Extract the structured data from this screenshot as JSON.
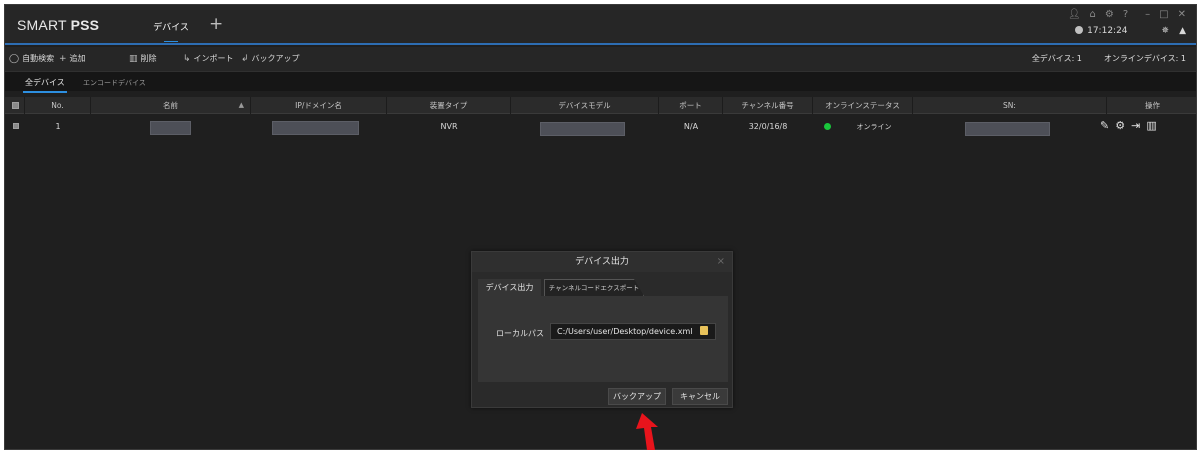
{
  "app": {
    "brand_light": "SMART ",
    "brand_bold": "PSS",
    "main_tab": "デバイス",
    "add_tab_symbol": "+",
    "clock": "17:12:24"
  },
  "toolbar": {
    "auto_search": "自動検索",
    "add": "追加",
    "delete": "削除",
    "import": "インポート",
    "backup": "バックアップ",
    "all_devices": "全デバイス: 1",
    "online_devices": "オンラインデバイス: 1"
  },
  "subtabs": {
    "all": "全デバイス",
    "encode": "エンコードデバイス"
  },
  "table": {
    "headers": [
      "No.",
      "名前",
      "IP/ドメイン名",
      "装置タイプ",
      "デバイスモデル",
      "ポート",
      "チャンネル番号",
      "オンラインステータス",
      "SN:",
      "操作"
    ],
    "rows": [
      {
        "no": "1",
        "type": "NVR",
        "port": "N/A",
        "channels": "32/0/16/8",
        "status": "オンライン"
      }
    ]
  },
  "dialog": {
    "title": "デバイス出力",
    "close": "×",
    "tab1": "デバイス出力",
    "tab2": "チャンネルコードエクスポート",
    "path_label": "ローカルパス",
    "path_value": "C:/Users/user/Desktop/device.xml",
    "backup_button": "バックアップ",
    "cancel_button": "キャンセル"
  },
  "colors": {
    "accent": "#2d8fe0",
    "online": "#19c63b",
    "arrow": "#e8141c"
  }
}
